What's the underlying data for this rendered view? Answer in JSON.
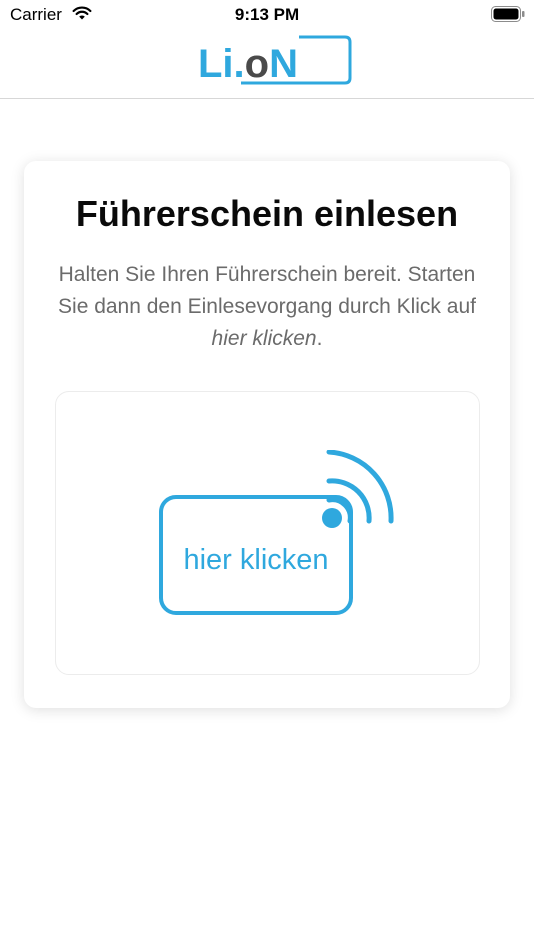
{
  "status_bar": {
    "carrier": "Carrier",
    "time": "9:13 PM"
  },
  "logo": {
    "text": "Li.oN",
    "colors": {
      "primary": "#2fa8de",
      "secondary": "#4a4a4a"
    }
  },
  "card": {
    "title": "Führerschein einlesen",
    "text_lead": "Halten Sie Ihren Führerschein bereit. Starten Sie dann den Einlesevorgang durch Klick auf",
    "text_emphasis": "hier klicken",
    "text_end": "."
  },
  "scan_button": {
    "label": "hier klicken",
    "icon": "nfc-card-icon",
    "accent_color": "#2fa8de"
  }
}
